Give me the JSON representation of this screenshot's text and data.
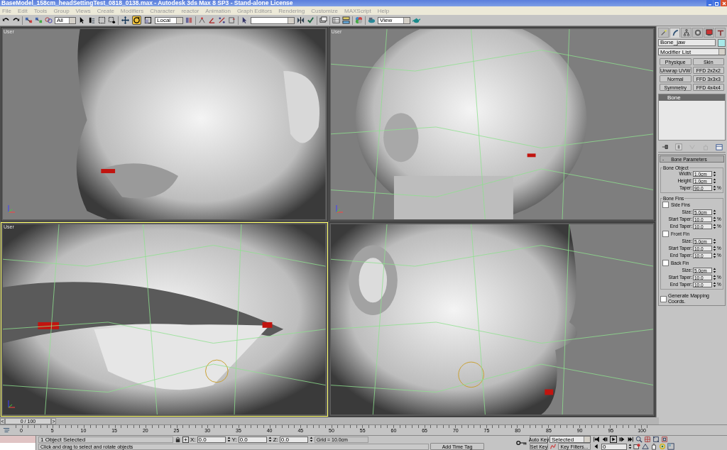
{
  "window": {
    "title": "BaseModel_158cm_headSettingTest_0818_0138.max - Autodesk 3ds Max 8 SP3  - Stand-alone License"
  },
  "menu": [
    "File",
    "Edit",
    "Tools",
    "Group",
    "Views",
    "Create",
    "Modifiers",
    "Character",
    "reactor",
    "Animation",
    "Graph Editors",
    "Rendering",
    "Customize",
    "MAXScript",
    "Help"
  ],
  "toolbar": {
    "selection_filter": "All",
    "coordinate_system": "Local",
    "render_type": "View",
    "transform_tools": [
      {
        "kind": "move",
        "selected": false
      },
      {
        "kind": "rotate",
        "selected": true
      },
      {
        "kind": "scale",
        "selected": false
      }
    ]
  },
  "viewports": [
    {
      "label": "User",
      "kind": "shaded",
      "selected": false
    },
    {
      "label": "User",
      "kind": "wire",
      "selected": false
    },
    {
      "label": "User",
      "kind": "wire",
      "selected": true
    },
    {
      "kind": "wire",
      "selected": false
    }
  ],
  "command_panel": {
    "tabs": [
      {
        "kind": "create",
        "selected": false
      },
      {
        "kind": "modify",
        "selected": true
      },
      {
        "kind": "hierarchy",
        "selected": false
      },
      {
        "kind": "motion",
        "selected": false
      },
      {
        "kind": "display",
        "selected": false
      },
      {
        "kind": "utilities",
        "selected": false
      }
    ],
    "object_name": "Bone_jaw",
    "modifier_list": "Modifier List",
    "modifier_buttons": [
      "Physique",
      "Skin",
      "Unwrap UVW",
      "FFD 2x2x2",
      "Normal",
      "FFD 3x3x3",
      "Symmetry",
      "FFD 4x4x4"
    ],
    "stack": [
      {
        "label": "Bone",
        "selected": true
      }
    ],
    "rollout": {
      "title": "Bone Parameters",
      "collapse": "-",
      "bone_object": {
        "title": "Bone Object",
        "fields": [
          {
            "label": "Width:",
            "value": "1.0cm"
          },
          {
            "label": "Height:",
            "value": "1.0cm"
          },
          {
            "label": "Taper:",
            "value": "90.0",
            "unit": "%"
          }
        ]
      },
      "bone_fins": {
        "title": "Bone Fins",
        "fins": [
          {
            "label": "Side Fins",
            "checked": false,
            "fields": [
              {
                "label": "Size:",
                "value": "5.0cm"
              },
              {
                "label": "Start Taper:",
                "value": "10.0",
                "unit": "%"
              },
              {
                "label": "End Taper:",
                "value": "10.0",
                "unit": "%"
              }
            ]
          },
          {
            "label": "Front Fin",
            "checked": false,
            "fields": [
              {
                "label": "Size:",
                "value": "5.0cm"
              },
              {
                "label": "Start Taper:",
                "value": "10.0",
                "unit": "%"
              },
              {
                "label": "End Taper:",
                "value": "10.0",
                "unit": "%"
              }
            ]
          },
          {
            "label": "Back Fin",
            "checked": false,
            "fields": [
              {
                "label": "Size:",
                "value": "5.0cm"
              },
              {
                "label": "Start Taper:",
                "value": "10.0",
                "unit": "%"
              },
              {
                "label": "End Taper:",
                "value": "10.0",
                "unit": "%"
              }
            ]
          }
        ]
      },
      "mapping": {
        "label": "Generate Mapping Coords.",
        "checked": false
      }
    }
  },
  "time_slider": {
    "prev": "<",
    "reading": "0 / 100",
    "next": ">",
    "level": 0
  },
  "track_bar": {
    "ticks": [
      "0",
      "5",
      "10",
      "15",
      "20",
      "25",
      "30",
      "35",
      "40",
      "45",
      "50",
      "55",
      "60",
      "65",
      "70",
      "75",
      "80",
      "85",
      "90",
      "95",
      "100"
    ]
  },
  "status_bar": {
    "selection": "1 Object Selected",
    "prompt": "Click and drag to select and rotate objects",
    "coords": [
      {
        "label": "X:",
        "value": "0.0"
      },
      {
        "label": "Y:",
        "value": "0.0"
      },
      {
        "label": "Z:",
        "value": "0.0"
      }
    ],
    "grid": "Grid = 10.0cm",
    "time_tag": "Add Time Tag",
    "auto_key": "Auto Key",
    "set_key": "Set Key",
    "key_mode": "Selected",
    "key_filters": "Key Filters...",
    "frame": "0"
  }
}
